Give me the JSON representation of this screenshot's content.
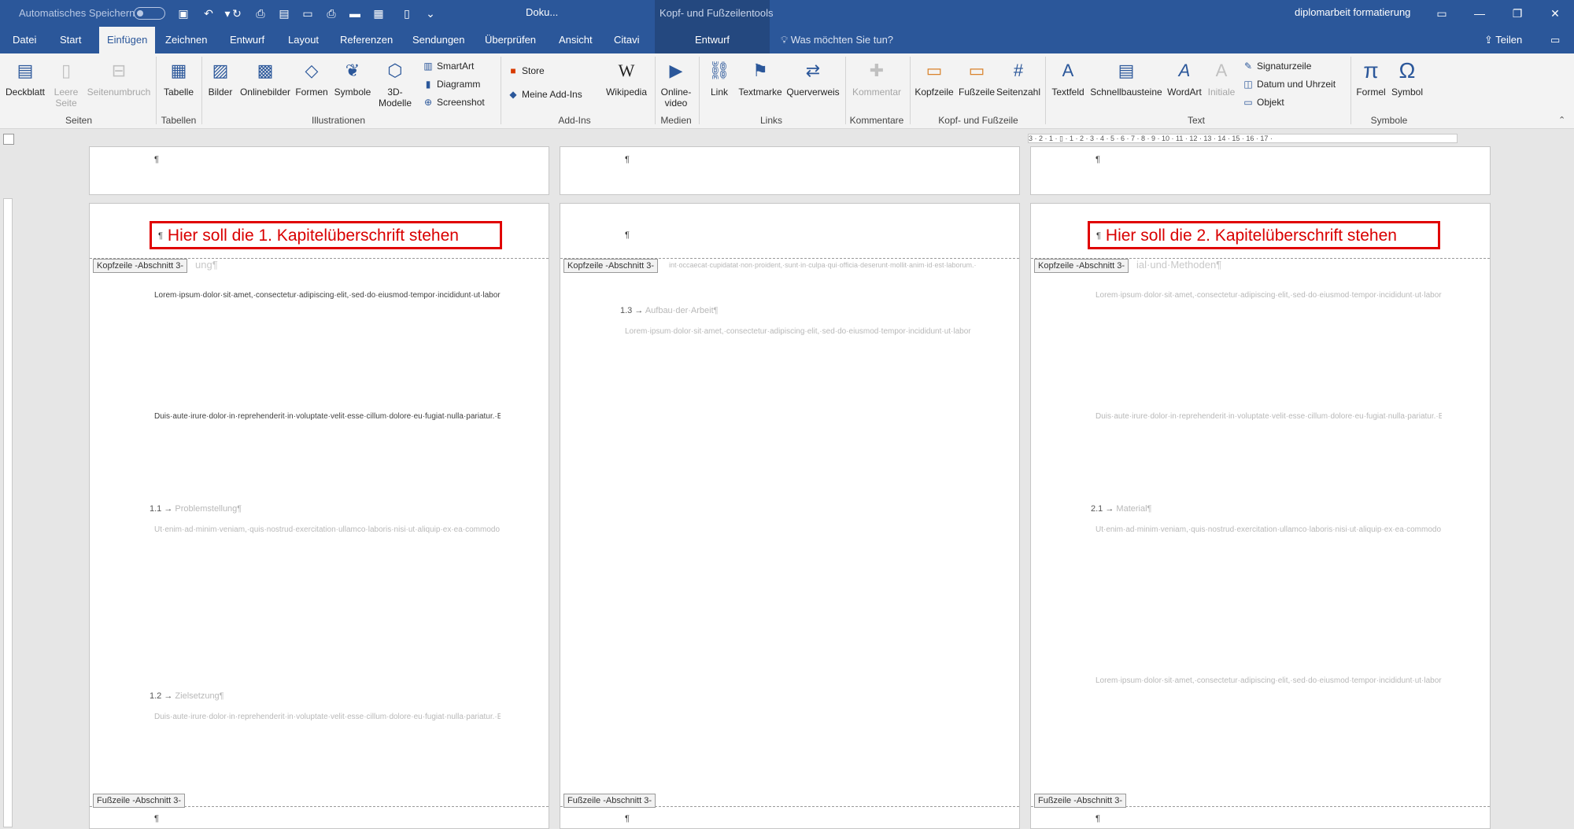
{
  "titlebar": {
    "autosave_label": "Automatisches Speichern",
    "doc_title": "Doku...",
    "tools_title": "Kopf- und Fußzeilentools",
    "user": "diplomarbeit formatierung"
  },
  "tabs": {
    "datei": "Datei",
    "start": "Start",
    "einfuegen": "Einfügen",
    "zeichnen": "Zeichnen",
    "entwurf": "Entwurf",
    "layout": "Layout",
    "referenzen": "Referenzen",
    "sendungen": "Sendungen",
    "ueberpruefen": "Überprüfen",
    "ansicht": "Ansicht",
    "citavi": "Citavi",
    "entwurf_ctx": "Entwurf",
    "tellme": "Was möchten Sie tun?",
    "share": "Teilen"
  },
  "ribbon": {
    "deckblatt": "Deckblatt",
    "leere_seite": "Leere Seite",
    "seitenumbruch": "Seitenumbruch",
    "tabelle": "Tabelle",
    "bilder": "Bilder",
    "onlinebilder": "Onlinebilder",
    "formen": "Formen",
    "symbole": "Symbole",
    "modelle": "3D-Modelle",
    "smartart": "SmartArt",
    "diagramm": "Diagramm",
    "screenshot": "Screenshot",
    "store": "Store",
    "meine_addins": "Meine Add-Ins",
    "wikipedia": "Wikipedia",
    "onlinevideo": "Online-video",
    "link": "Link",
    "textmarke": "Textmarke",
    "querverweis": "Querverweis",
    "kommentar": "Kommentar",
    "kopfzeile": "Kopfzeile",
    "fusszeile": "Fußzeile",
    "seitenzahl": "Seitenzahl",
    "textfeld": "Textfeld",
    "schnellbausteine": "Schnellbausteine",
    "wordart": "WordArt",
    "initiale": "Initiale",
    "signaturzeile": "Signaturzeile",
    "datum_uhrzeit": "Datum und Uhrzeit",
    "objekt": "Objekt",
    "formel": "Formel",
    "symbol": "Symbol"
  },
  "groups": {
    "seiten": "Seiten",
    "tabellen": "Tabellen",
    "illustrationen": "Illustrationen",
    "addins": "Add-Ins",
    "medien": "Medien",
    "links": "Links",
    "kommentare": "Kommentare",
    "kopf_fuss": "Kopf- und Fußzeile",
    "text": "Text",
    "symbole": "Symbole"
  },
  "ruler": {
    "ticks": "3 · 2 · 1 · ▯ · 1 · 2 · 3 · 4 · 5 · 6 · 7 · 8 · 9 · 10 · 11 · 12 · 13 · 14 · 15 · 16 · 17 ·"
  },
  "doc": {
    "pilcrow": "¶",
    "header_tag": "Kopfzeile -Abschnitt 3-",
    "footer_tag": "Fußzeile -Abschnitt 3-",
    "heading1": "Hier soll die 1. Kapitelüberschrift stehen",
    "heading2": "Hier soll die 2. Kapitelüberschrift stehen",
    "ghost_left": "ung¶",
    "ghost_right": "ial·und·Methoden¶",
    "ghost_mid": "int·occaecat·cupidatat·non·proident,·sunt·in·culpa·qui·officia·deserunt·mollit·anim·id·est·laborum.·¶",
    "h11_num": "1.1 →",
    "h11": "Problemstellung¶",
    "h12_num": "1.2 →",
    "h12": "Zielsetzung¶",
    "h13_num": "1.3 →",
    "h13": "Aufbau·der·Arbeit¶",
    "h21_num": "2.1 →",
    "h21": "Material¶",
    "lorem_a": "Lorem·ipsum·dolor·sit·amet,·consectetur·adipiscing·elit,·sed·do·eiusmod·tempor·incididunt·ut·labore·et·dolore·magna·aliqua.·Ut·enim·ad·minim·veniam,·quis·nostrud·exercitation·ullamco·laboris·nisi·ut·aliquip·ex·ea·commodo·consequat.·Duis·aute·irure·dolor·in·reprehenderit·in·voluptate·velit·esse·cillum·dolore·eu·fugiat·nulla·pariatur.·Excepteur·sint·occaecat·cupidatat·non·proident,·sunt·in·culpa·qui·officia·deserunt·mollit·anim·id·est·laborum.·Lorem·ipsum·dolor·sit·amet,·consectetur·adipiscing·elit,·sed·do·eiusmod·tempor·incididunt·ut·labore·et·dolore·magna·aliqua.·Ut·enim·ad·minim·veniam,·quis·nostrud·exercitation·ullamco·laboris·nisi·ut·aliquip·ex·ea·commodo·consequat.·¶",
    "lorem_b": "Duis·aute·irure·dolor·in·reprehenderit·in·voluptate·velit·esse·cillum·dolore·eu·fugiat·nulla·pariatur.·Excepteur·sint·occaecat·cupidatat·non·proident,·sunt·in·culpa·qui·officia·deserunt·mollit·anim·id·est·laborum.·Lorem·ipsum·dolor·sit·amet,·consectetur·adipiscing·elit,·sed·do·eiusmod·tempor·incididunt·ut·labore·et·dolore·magna·aliqua.·Ut·enim·ad·minim·veniam,·quis·nostrud·exercitation·ullamco·laboris·nisi·ut·aliquip·ex·ea·commodo·consequat.·¶",
    "lorem_c": "Ut·enim·ad·minim·veniam,·quis·nostrud·exercitation·ullamco·laboris·nisi·ut·aliquip·ex·ea·commodo·consequat.·Duis·aute·irure·dolor·in·reprehenderit·in·voluptate·velit·esse·cillum·dolore·eu·fugiat·nulla·pariatur.·Excepteur·sint·occaecat·cupidatat·non·proident,·sunt·in·culpa·qui·officia·deserunt·mollit·anim·id·est·laborum.·Lorem·ipsum·dolor·sit·amet,·consectetur·adipiscing·elit,·sed·do·eiusmod·tempor·incididunt·ut·labore·et·dolore·magna·aliqua.·Ut·enim·ad·minim·veniam,·quis·nostrud·exercitation·ullamco·laboris·nisi·ut·aliquip·ex·ea·commodo·consequat.·Duis·aute·irure·dolor·in·reprehenderit·in·voluptate·velit·esse·cillum·dolore·eu·fugiat·nulla·pariatur.·Excepteur·sint·occaecat·cupidatat·non·proident,·sunt·in·culpa·qui·officia·deserunt·mollit·anim·id·est·laborum.·Lorem·ipsum·dolor·sit·amet,·consectetur·adipiscing·elit,·sed·do·eiusmod·tempor·incididunt·ut·labore·et·dolore·magna·aliqua.·¶",
    "lorem_d": "Duis·aute·irure·dolor·in·reprehenderit·in·voluptate·velit·esse·cillum·dolore·eu·fugiat·nulla·pariatur.·Excepteur·sint·occaecat·cupidatat·non·proident,·sunt·in·culpa·qui·officia·deserunt·mollit·anim·id·est·laborum.·Lorem·ipsum·dolor·sit·amet,·consectetur·adipiscing·elit,·sed·do·eiusmod·tempor·incididunt·ut·labore·et·dolore·magna·aliqua.·Ut·enim·ad·minim·veniam,·quis·nostrud·exercitation·ullamco·laboris·nisi·ut·aliquip·ex·ea·commodo·consequat.·Duis·aute·irure·dolor·in·reprehenderit·in·voluptate·velit·esse·cillum·dolore·eu·fugiat·nulla·pariatur."
  }
}
